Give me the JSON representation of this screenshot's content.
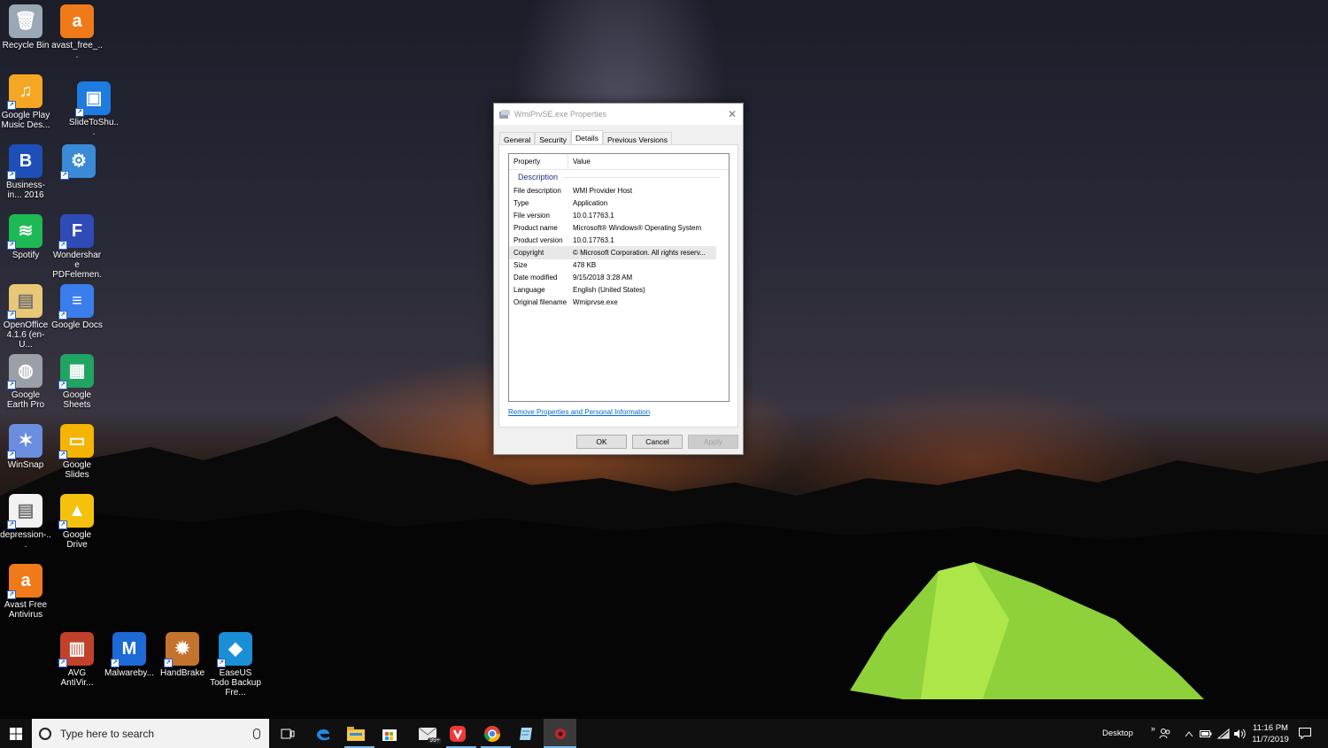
{
  "desktop_icons": [
    {
      "label": "Recycle Bin",
      "icon": "recycle-bin-icon",
      "color": "#9aa7b4"
    },
    {
      "label": "avast_free_...",
      "icon": "avast-icon",
      "color": "#f07a1a"
    },
    {
      "label": "Google Play Music Des...",
      "icon": "google-play-music-icon",
      "color": "#f5a623"
    },
    {
      "label": "SlideToShu...",
      "icon": "slidetoshutdown-icon",
      "color": "#1e7be0"
    },
    {
      "label": "Business-in... 2016",
      "icon": "business-icon",
      "color": "#1d4fb8"
    },
    {
      "label": "",
      "icon": "control-panel-icon",
      "color": "#3a8ad8"
    },
    {
      "label": "Spotify",
      "icon": "spotify-icon",
      "color": "#1db954"
    },
    {
      "label": "Wondershare PDFelemen...",
      "icon": "wondershare-icon",
      "color": "#2f4bb8"
    },
    {
      "label": "OpenOffice 4.1.6 (en-U...",
      "icon": "openoffice-icon",
      "color": "#e8c776"
    },
    {
      "label": "Google Docs",
      "icon": "google-docs-icon",
      "color": "#3b7ded"
    },
    {
      "label": "Google Earth Pro",
      "icon": "google-earth-icon",
      "color": "#9aa0a6"
    },
    {
      "label": "Google Sheets",
      "icon": "google-sheets-icon",
      "color": "#1fa463"
    },
    {
      "label": "WinSnap",
      "icon": "winsnap-icon",
      "color": "#6b8de0"
    },
    {
      "label": "Google Slides",
      "icon": "google-slides-icon",
      "color": "#f4b400"
    },
    {
      "label": "depression-...",
      "icon": "document-icon",
      "color": "#f2f2f2"
    },
    {
      "label": "Google Drive",
      "icon": "google-drive-icon",
      "color": "#f4c20d"
    },
    {
      "label": "Avast Free Antivirus",
      "icon": "avast-antivirus-icon",
      "color": "#f07a1a"
    },
    {
      "label": "AVG AntiVir...",
      "icon": "avg-icon",
      "color": "#c2412b"
    },
    {
      "label": "Malwareby...",
      "icon": "malwarebytes-icon",
      "color": "#1c6ad6"
    },
    {
      "label": "HandBrake",
      "icon": "handbrake-icon",
      "color": "#c3732e"
    },
    {
      "label": "EaseUS Todo Backup Fre...",
      "icon": "easeus-icon",
      "color": "#1a8fd6"
    }
  ],
  "dialog": {
    "title": "WmiPrvSE.exe Properties",
    "tabs": [
      "General",
      "Security",
      "Details",
      "Previous Versions"
    ],
    "active_tab": "Details",
    "columns": {
      "property": "Property",
      "value": "Value"
    },
    "group": "Description",
    "rows": [
      {
        "k": "File description",
        "v": "WMI Provider Host"
      },
      {
        "k": "Type",
        "v": "Application"
      },
      {
        "k": "File version",
        "v": "10.0.17763.1"
      },
      {
        "k": "Product name",
        "v": "Microsoft® Windows® Operating System"
      },
      {
        "k": "Product version",
        "v": "10.0.17763.1"
      },
      {
        "k": "Copyright",
        "v": "© Microsoft Corporation. All rights reserv..."
      },
      {
        "k": "Size",
        "v": "478 KB"
      },
      {
        "k": "Date modified",
        "v": "9/15/2018 3:28 AM"
      },
      {
        "k": "Language",
        "v": "English (United States)"
      },
      {
        "k": "Original filename",
        "v": "Wmiprvse.exe"
      }
    ],
    "link": "Remove Properties and Personal Information",
    "ok": "OK",
    "cancel": "Cancel",
    "apply": "Apply"
  },
  "taskbar": {
    "search_placeholder": "Type here to search",
    "mail_badge": "99+",
    "desktop_label": "Desktop",
    "chevron": "»",
    "time": "11:16 PM",
    "date": "11/7/2019",
    "accent": "#76b9ed"
  }
}
